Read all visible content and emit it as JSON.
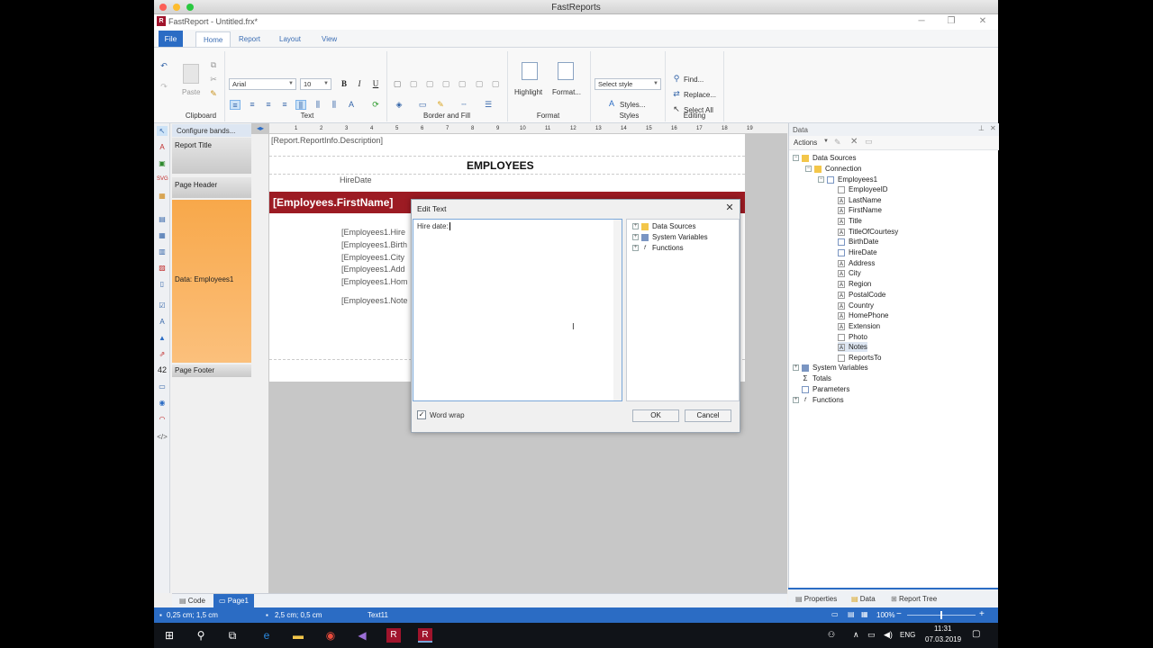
{
  "mac": {
    "title": "FastReports"
  },
  "app": {
    "title": "FastReport - Untitled.frx*",
    "menu": {
      "file": "File",
      "tabs": [
        "Home",
        "Report",
        "Layout",
        "View"
      ]
    },
    "ribbon": {
      "paste": "Paste",
      "font_name": "Arial",
      "font_size": "10",
      "bold": "B",
      "italic": "I",
      "underline": "U",
      "highlight": "Highlight",
      "format": "Format...",
      "style_select": "Select style",
      "styles": "Styles...",
      "find": "Find...",
      "replace": "Replace...",
      "select_all": "Select All",
      "groups": [
        "Clipboard",
        "Text",
        "Border and Fill",
        "Format",
        "Styles",
        "Editing"
      ]
    }
  },
  "bands": {
    "configure": "Configure bands...",
    "items": [
      "Report Title",
      "Page Header",
      "Data: Employees1",
      "Page Footer"
    ]
  },
  "design": {
    "ruler_numbers": [
      "1",
      "2",
      "3",
      "4",
      "5",
      "6",
      "7",
      "8",
      "9",
      "10",
      "11",
      "12",
      "13",
      "14",
      "15",
      "16",
      "17",
      "18",
      "19"
    ],
    "description": "[Report.ReportInfo.Description]",
    "employees_heading": "EMPLOYEES",
    "hire_date_label": "HireDate",
    "name_band": "[Employees.FirstName]",
    "fields": [
      "[Employees1.Hire",
      "[Employees1.Birth",
      "[Employees1.City",
      "[Employees1.Add",
      "[Employees1.Hom",
      "[Employees1.Note"
    ]
  },
  "dialog": {
    "title": "Edit Text",
    "text": "Hire date:",
    "tree": [
      "Data Sources",
      "System Variables",
      "Functions"
    ],
    "word_wrap": "Word wrap",
    "ok": "OK",
    "cancel": "Cancel"
  },
  "data_panel": {
    "title": "Data",
    "actions": "Actions",
    "tree": {
      "data_sources": "Data Sources",
      "connection": "Connection",
      "table": "Employees1",
      "columns": [
        "EmployeeID",
        "LastName",
        "FirstName",
        "Title",
        "TitleOfCourtesy",
        "BirthDate",
        "HireDate",
        "Address",
        "City",
        "Region",
        "PostalCode",
        "Country",
        "HomePhone",
        "Extension",
        "Photo",
        "Notes",
        "ReportsTo"
      ],
      "others": [
        "System Variables",
        "Totals",
        "Parameters",
        "Functions"
      ]
    },
    "tabs": [
      "Properties",
      "Data",
      "Report Tree"
    ]
  },
  "bottom": {
    "code": "Code",
    "page": "Page1"
  },
  "status": {
    "pos": "0,25 cm; 1,5 cm",
    "size": "2,5 cm; 0,5 cm",
    "obj": "Text11",
    "zoom": "100%"
  },
  "taskbar": {
    "lang": "ENG",
    "time": "11:31",
    "date": "07.03.2019"
  },
  "colors": {
    "accent": "#2b6cc4",
    "band_orange": "#f8a84a",
    "band_red": "#9c1b23"
  }
}
